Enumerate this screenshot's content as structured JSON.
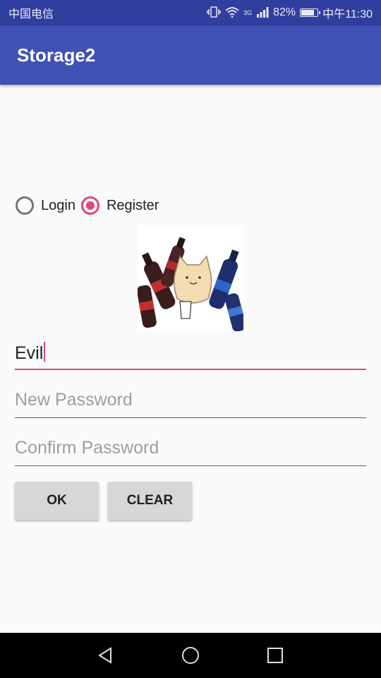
{
  "status_bar": {
    "carrier": "中国电信",
    "network": "3G",
    "battery": "82%",
    "battery_level": 0.82,
    "time": "中午11:30"
  },
  "app_bar": {
    "title": "Storage2"
  },
  "mode": {
    "options": [
      {
        "label": "Login",
        "checked": false
      },
      {
        "label": "Register",
        "checked": true
      }
    ]
  },
  "form": {
    "username": {
      "value": "Evil"
    },
    "new_password": {
      "placeholder": "New Password",
      "value": ""
    },
    "confirm_password": {
      "placeholder": "Confirm Password",
      "value": ""
    }
  },
  "buttons": {
    "ok": "OK",
    "clear": "CLEAR"
  },
  "colors": {
    "primary": "#3f51b5",
    "primary_dark": "#303f9f",
    "accent": "#e0457b"
  },
  "icons": {
    "nav_back": "back-triangle-icon",
    "nav_home": "home-circle-icon",
    "nav_recents": "recents-square-icon"
  }
}
